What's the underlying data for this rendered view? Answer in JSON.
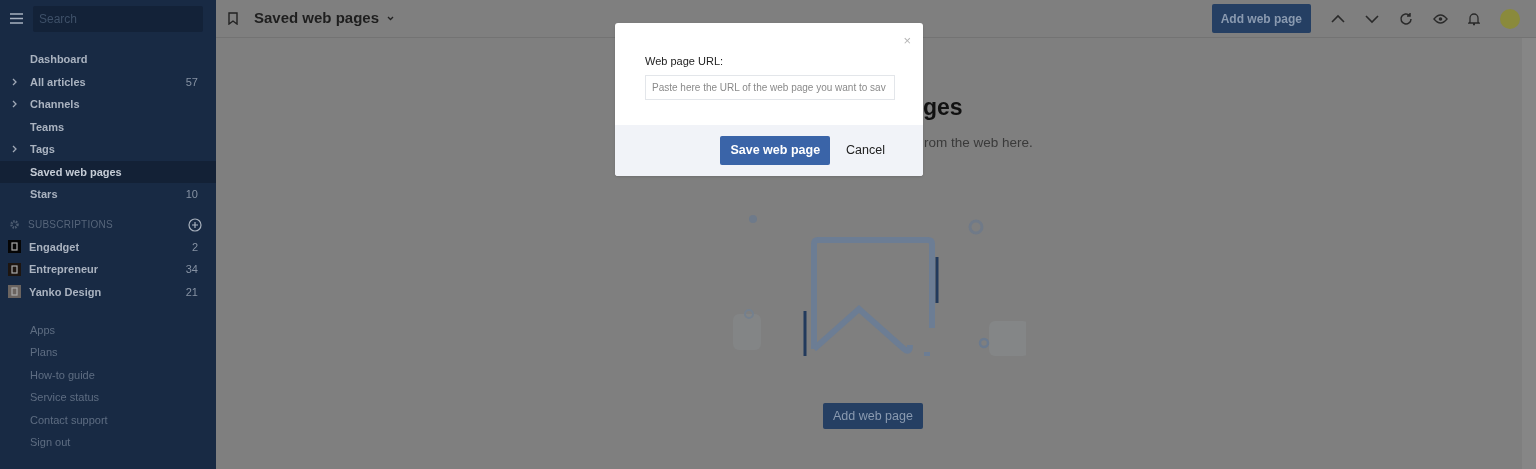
{
  "sidebar": {
    "search": {
      "placeholder": "Search"
    },
    "nav": [
      {
        "label": "Dashboard",
        "expandable": false,
        "selected": false
      },
      {
        "label": "All articles",
        "count": "57",
        "expandable": true,
        "selected": false
      },
      {
        "label": "Channels",
        "expandable": true,
        "selected": false
      },
      {
        "label": "Teams",
        "expandable": false,
        "selected": false
      },
      {
        "label": "Tags",
        "expandable": true,
        "selected": false
      },
      {
        "label": "Saved web pages",
        "expandable": false,
        "selected": true
      },
      {
        "label": "Stars",
        "count": "10",
        "expandable": false,
        "selected": false
      }
    ],
    "subscriptions": {
      "heading": "SUBSCRIPTIONS",
      "items": [
        {
          "name": "Engadget",
          "count": "2"
        },
        {
          "name": "Entrepreneur",
          "count": "34"
        },
        {
          "name": "Yanko Design",
          "count": "21"
        }
      ]
    },
    "footer_links": [
      "Apps",
      "Plans",
      "How-to guide",
      "Service status",
      "Contact support",
      "Sign out"
    ]
  },
  "topbar": {
    "title": "Saved web pages",
    "add_button": "Add web page"
  },
  "empty_state": {
    "heading_visible": "ges",
    "text_visible": "rom the web here.",
    "button": "Add web page"
  },
  "dialog": {
    "close": "×",
    "label": "Web page URL:",
    "placeholder": "Paste here the URL of the web page you want to sav",
    "save_button": "Save web page",
    "cancel_button": "Cancel"
  }
}
